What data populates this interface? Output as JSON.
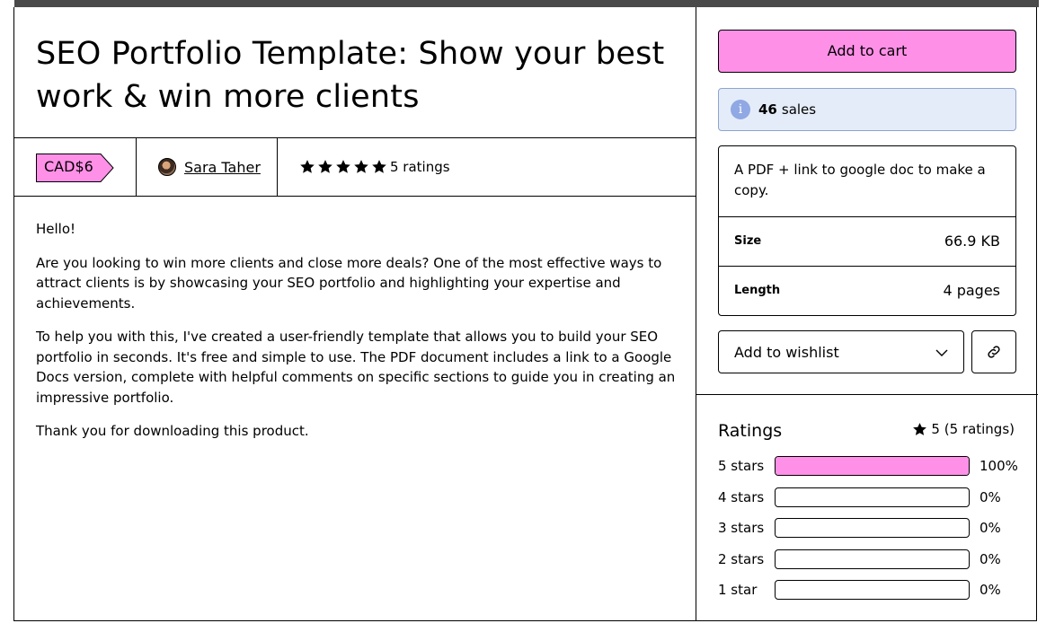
{
  "product": {
    "title": "SEO Portfolio Template: Show your best work & win more clients",
    "price": "CAD$6",
    "author": "Sara Taher",
    "rating_stars": 5,
    "ratings_label": "5 ratings"
  },
  "description": [
    "Hello!",
    "Are you looking to win more clients and close more deals? One of the most effective ways to attract clients is by showcasing your SEO portfolio and highlighting your expertise and achievements.",
    "To help you with this, I've created a user-friendly template that allows you to build your SEO portfolio in seconds. It's free and simple to use. The PDF document includes a link to a Google Docs version, complete with helpful comments on specific sections to guide you in creating an impressive portfolio.",
    "Thank you for downloading this product."
  ],
  "sidebar": {
    "add_to_cart": "Add to cart",
    "sales_count": "46",
    "sales_label": "sales",
    "summary": "A PDF + link to google doc to make a copy.",
    "size_label": "Size",
    "size_value": "66.9 KB",
    "length_label": "Length",
    "length_value": "4 pages",
    "wishlist_label": "Add to wishlist"
  },
  "ratings": {
    "title": "Ratings",
    "summary": "5 (5 ratings)",
    "breakdown": [
      {
        "label": "5 stars",
        "pct": "100%",
        "fraction": 1.0
      },
      {
        "label": "4 stars",
        "pct": "0%",
        "fraction": 0.0
      },
      {
        "label": "3 stars",
        "pct": "0%",
        "fraction": 0.0
      },
      {
        "label": "2 stars",
        "pct": "0%",
        "fraction": 0.0
      },
      {
        "label": "1 star",
        "pct": "0%",
        "fraction": 0.0
      }
    ]
  },
  "colors": {
    "accent_pink": "#ff90e8",
    "info_bg": "#e4ecf9",
    "info_icon": "#90a8e3"
  },
  "icons": [
    "info-icon",
    "star-icon",
    "chevron-down-icon",
    "link-icon",
    "avatar"
  ]
}
